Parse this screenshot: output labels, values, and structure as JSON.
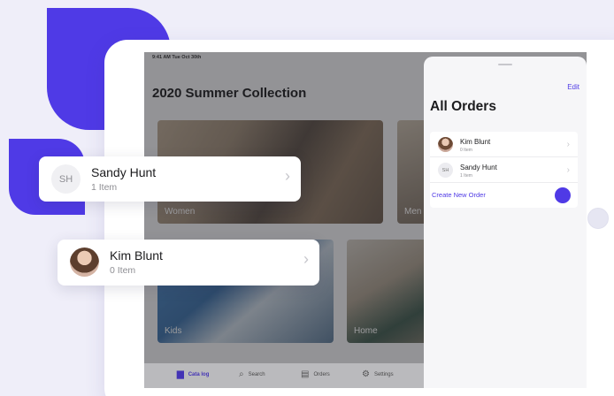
{
  "status_bar": {
    "time": "9:41 AM  Tue Oct 30th"
  },
  "catalog": {
    "title": "2020 Summer Collection",
    "tiles": [
      {
        "label": "Women"
      },
      {
        "label": "Men"
      },
      {
        "label": "Kids"
      },
      {
        "label": "Home"
      }
    ]
  },
  "tabbar": {
    "items": [
      {
        "label": "Cata log",
        "icon": "bag-icon",
        "glyph": "▆",
        "active": true
      },
      {
        "label": "Search",
        "icon": "search-icon",
        "glyph": "⌕"
      },
      {
        "label": "Orders",
        "icon": "orders-icon",
        "glyph": "▤"
      },
      {
        "label": "Settings",
        "icon": "gear-icon",
        "glyph": "⚙"
      }
    ]
  },
  "orders_sheet": {
    "edit_label": "Edit",
    "title": "All Orders",
    "orders": [
      {
        "name": "Kim Blunt",
        "count": "0 Item",
        "avatar": "photo"
      },
      {
        "name": "Sandy Hunt",
        "count": "1 Item",
        "initials": "SH"
      }
    ],
    "create_label": "Create New Order",
    "chevron": "›"
  },
  "floating_cards": [
    {
      "name": "Sandy Hunt",
      "count": "1 Item",
      "initials": "SH"
    },
    {
      "name": "Kim Blunt",
      "count": "0 Item",
      "avatar": "photo"
    }
  ],
  "colors": {
    "accent": "#4f3ae6",
    "background": "#efeef9"
  }
}
